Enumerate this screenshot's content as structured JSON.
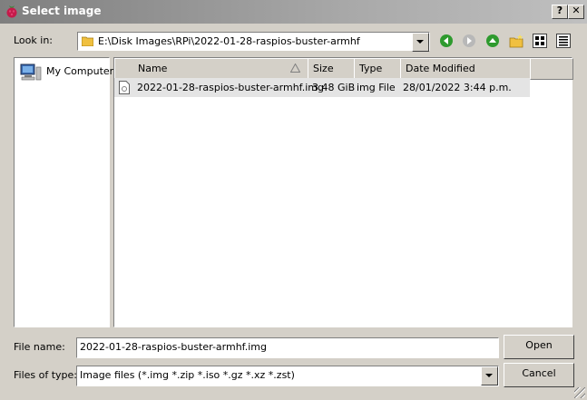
{
  "window": {
    "title": "Select image",
    "help_label": "?",
    "close_label": "✕"
  },
  "lookin": {
    "label": "Look in:",
    "path": "E:\\Disk Images\\RPi\\2022-01-28-raspios-buster-armhf"
  },
  "toolbar": {
    "icons": [
      "back-icon",
      "forward-icon",
      "up-icon",
      "new-folder-icon",
      "list-view-icon",
      "detail-view-icon"
    ]
  },
  "sidebar": {
    "items": [
      {
        "label": "My Computer",
        "icon": "computer-icon"
      }
    ]
  },
  "filelist": {
    "columns": [
      "Name",
      "Size",
      "Type",
      "Date Modified"
    ],
    "rows": [
      {
        "name": "2022-01-28-raspios-buster-armhf.img",
        "size": "3.48 GiB",
        "type": "img File",
        "date": "28/01/2022 3:44 p.m."
      }
    ]
  },
  "filename": {
    "label": "File name:",
    "value": "2022-01-28-raspios-buster-armhf.img"
  },
  "filetype": {
    "label": "Files of type:",
    "value": "Image files (*.img *.zip *.iso *.gz *.xz *.zst)"
  },
  "buttons": {
    "open": "Open",
    "cancel": "Cancel"
  },
  "colors": {
    "titlebar": "#a9a9a9",
    "selected_row": "#e4e4e4",
    "nav_green": "#2e9a2e"
  }
}
